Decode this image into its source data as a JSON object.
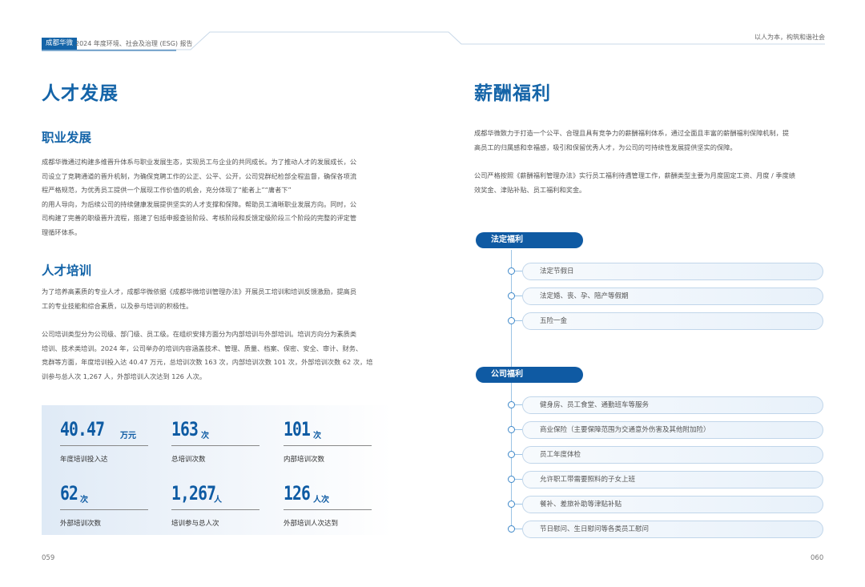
{
  "header": {
    "badge": "成都华微",
    "title": "2024 年度环境、社会及治理 (ESG) 报告",
    "right": "以人为本，构筑和谐社会"
  },
  "left": {
    "title": "人才发展",
    "career": {
      "heading": "职业发展",
      "lines": [
        "成都华微通过构建多维晋升体系与职业发展生态，实现员工与企业的共同成长。为了推动人才的发展成长，公",
        "司设立了竞聘通道的晋升机制，为确保竞聘工作的公正、公平、公开，公司党群纪检部全程监督，确保各项流",
        "程严格规范，为优秀员工提供一个展现工作价值的机会，充分体现了“能者上”“庸者下”",
        "的用人导向，为后续公司的持续健康发展提供坚实的人才支撑和保障。帮助员工清晰职业发展方向。同时，公",
        "司构建了完善的职级晋升流程，搭建了包括申报查验阶段、考核阶段和反馈定级阶段三个阶段的完整的评定管",
        "理循环体系。"
      ]
    },
    "training": {
      "heading": "人才培训",
      "p1_lines": [
        "为了培养高素质的专业人才，成都华微依据《成都华微培训管理办法》开展员工培训和培训反馈激励，提高员",
        "工的专业技能和综合素质，以及参与培训的积极性。"
      ],
      "p2_lines": [
        "公司培训类型分为公司级、部门级、员工级。在组织安排方面分为内部培训与外部培训。培训方向分为素质类",
        "培训、技术类培训。2024 年，公司举办的培训内容涵盖技术、管理、质量、档案、保密、安全、审计、财务、",
        "竞群等方面，年度培训投入达 40.47 万元，总培训次数 163 次，内部培训次数 101 次，外部培训次数 62 次，培",
        "训参与总人次 1,267 人，外部培训人次达到 126 人次。"
      ]
    },
    "stats": [
      {
        "value": "40.47",
        "unit": "万元",
        "label": "年度培训投入达"
      },
      {
        "value": "163",
        "unit": "次",
        "label": "总培训次数"
      },
      {
        "value": "101",
        "unit": "次",
        "label": "内部培训次数"
      },
      {
        "value": "62",
        "unit": "次",
        "label": "外部培训次数"
      },
      {
        "value": "1,267",
        "unit": "人",
        "label": "培训参与总人次"
      },
      {
        "value": "126",
        "unit": "人次",
        "label": "外部培训人次达到"
      }
    ],
    "page": "059"
  },
  "right": {
    "title": "薪酬福利",
    "p1_lines": [
      "成都华微致力于打造一个公平、合理且具有竞争力的薪酬福利体系，通过全面且丰富的薪酬福利保障机制，提",
      "高员工的归属感和幸福感，吸引和保留优秀人才，为公司的可持续性发展提供坚实的保障。"
    ],
    "p2_lines": [
      "公司严格按照《薪酬福利管理办法》实行员工福利待遇管理工作，薪酬类型主要为月度固定工资、月度 / 季度绩",
      "效奖金、津贴补贴、员工福利和奖金。"
    ],
    "statutory": {
      "label": "法定福利",
      "items": [
        "法定节假日",
        "法定婚、丧、孕、陪产等假期",
        "五险一金"
      ]
    },
    "company": {
      "label": "公司福利",
      "items": [
        "健身房、员工食堂、通勤班车等服务",
        "商业保险（主要保障范围为交通意外伤害及其他附加险）",
        "员工年度体检",
        "允许职工带需要照料的子女上班",
        "餐补、差旅补助等津贴补贴",
        "节日慰问、生日慰问等各类员工慰问"
      ]
    },
    "page": "060"
  }
}
